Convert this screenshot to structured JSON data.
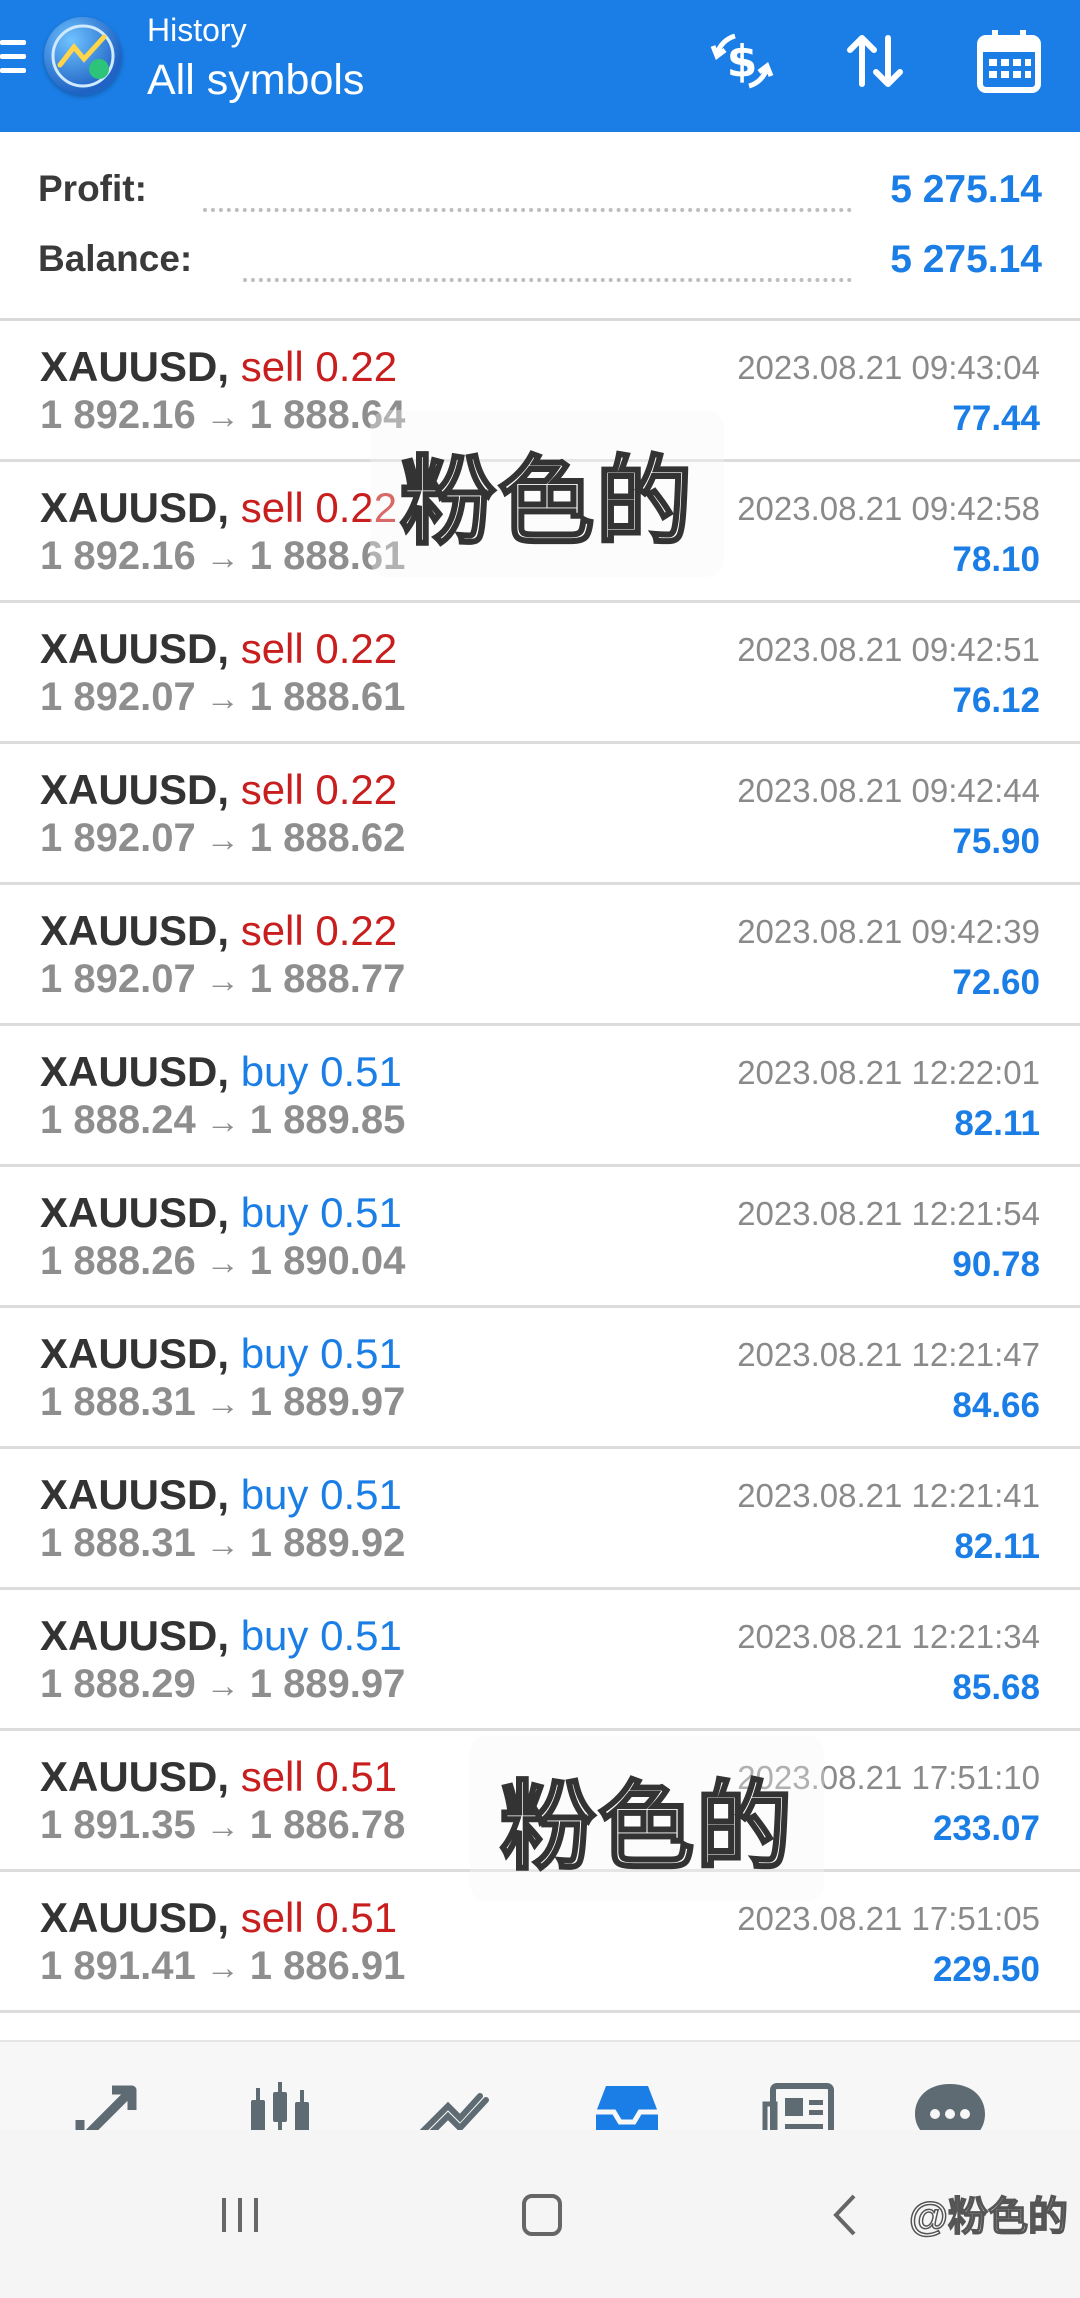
{
  "header": {
    "subtitle": "History",
    "title": "All symbols",
    "icons": [
      "menu-icon",
      "app-logo",
      "currency-exchange-icon",
      "sort-icon",
      "calendar-icon"
    ]
  },
  "summary": {
    "profit_label": "Profit:",
    "profit_value": "5 275.14",
    "balance_label": "Balance:",
    "balance_value": "5 275.14"
  },
  "deals": [
    {
      "symbol": "XAUUSD,",
      "side": "sell 0.22",
      "side_type": "sell",
      "open": "1 892.16",
      "close": "1 888.64",
      "time": "2023.08.21 09:43:04",
      "profit": "77.44"
    },
    {
      "symbol": "XAUUSD,",
      "side": "sell 0.22",
      "side_type": "sell",
      "open": "1 892.16",
      "close": "1 888.61",
      "time": "2023.08.21 09:42:58",
      "profit": "78.10"
    },
    {
      "symbol": "XAUUSD,",
      "side": "sell 0.22",
      "side_type": "sell",
      "open": "1 892.07",
      "close": "1 888.61",
      "time": "2023.08.21 09:42:51",
      "profit": "76.12"
    },
    {
      "symbol": "XAUUSD,",
      "side": "sell 0.22",
      "side_type": "sell",
      "open": "1 892.07",
      "close": "1 888.62",
      "time": "2023.08.21 09:42:44",
      "profit": "75.90"
    },
    {
      "symbol": "XAUUSD,",
      "side": "sell 0.22",
      "side_type": "sell",
      "open": "1 892.07",
      "close": "1 888.77",
      "time": "2023.08.21 09:42:39",
      "profit": "72.60"
    },
    {
      "symbol": "XAUUSD,",
      "side": "buy 0.51",
      "side_type": "buy",
      "open": "1 888.24",
      "close": "1 889.85",
      "time": "2023.08.21 12:22:01",
      "profit": "82.11"
    },
    {
      "symbol": "XAUUSD,",
      "side": "buy 0.51",
      "side_type": "buy",
      "open": "1 888.26",
      "close": "1 890.04",
      "time": "2023.08.21 12:21:54",
      "profit": "90.78"
    },
    {
      "symbol": "XAUUSD,",
      "side": "buy 0.51",
      "side_type": "buy",
      "open": "1 888.31",
      "close": "1 889.97",
      "time": "2023.08.21 12:21:47",
      "profit": "84.66"
    },
    {
      "symbol": "XAUUSD,",
      "side": "buy 0.51",
      "side_type": "buy",
      "open": "1 888.31",
      "close": "1 889.92",
      "time": "2023.08.21 12:21:41",
      "profit": "82.11"
    },
    {
      "symbol": "XAUUSD,",
      "side": "buy 0.51",
      "side_type": "buy",
      "open": "1 888.29",
      "close": "1 889.97",
      "time": "2023.08.21 12:21:34",
      "profit": "85.68"
    },
    {
      "symbol": "XAUUSD,",
      "side": "sell 0.51",
      "side_type": "sell",
      "open": "1 891.35",
      "close": "1 886.78",
      "time": "2023.08.21 17:51:10",
      "profit": "233.07"
    },
    {
      "symbol": "XAUUSD,",
      "side": "sell 0.51",
      "side_type": "sell",
      "open": "1 891.41",
      "close": "1 886.91",
      "time": "2023.08.21 17:51:05",
      "profit": "229.50"
    }
  ],
  "arrow": "→",
  "watermark": {
    "text": "粉色的",
    "handle": "@粉色的"
  },
  "bottom_nav": [
    "quotes-icon",
    "chart-icon",
    "trade-icon",
    "history-icon",
    "news-icon",
    "chat-icon"
  ],
  "colors": {
    "accent": "#1a7ee6",
    "sell": "#c81e1e",
    "buy": "#1a7ee6"
  }
}
